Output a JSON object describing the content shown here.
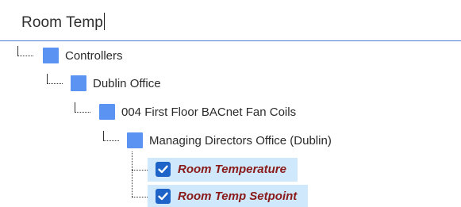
{
  "search": {
    "value": "Room Temp"
  },
  "tree": {
    "nodes": [
      {
        "label": "Controllers"
      },
      {
        "label": "Dublin Office"
      },
      {
        "label": "004 First Floor BACnet Fan Coils"
      },
      {
        "label": "Managing Directors Office (Dublin)"
      }
    ],
    "leaves": [
      {
        "label": "Room Temperature",
        "checked": true
      },
      {
        "label": "Room Temp Setpoint",
        "checked": true
      }
    ]
  },
  "colors": {
    "folder": "#5b93f2",
    "checkbox": "#1e64c8",
    "highlight": "#cfe8fb",
    "leaf_text": "#8a1a1a",
    "search_border": "#4a7fd6"
  }
}
